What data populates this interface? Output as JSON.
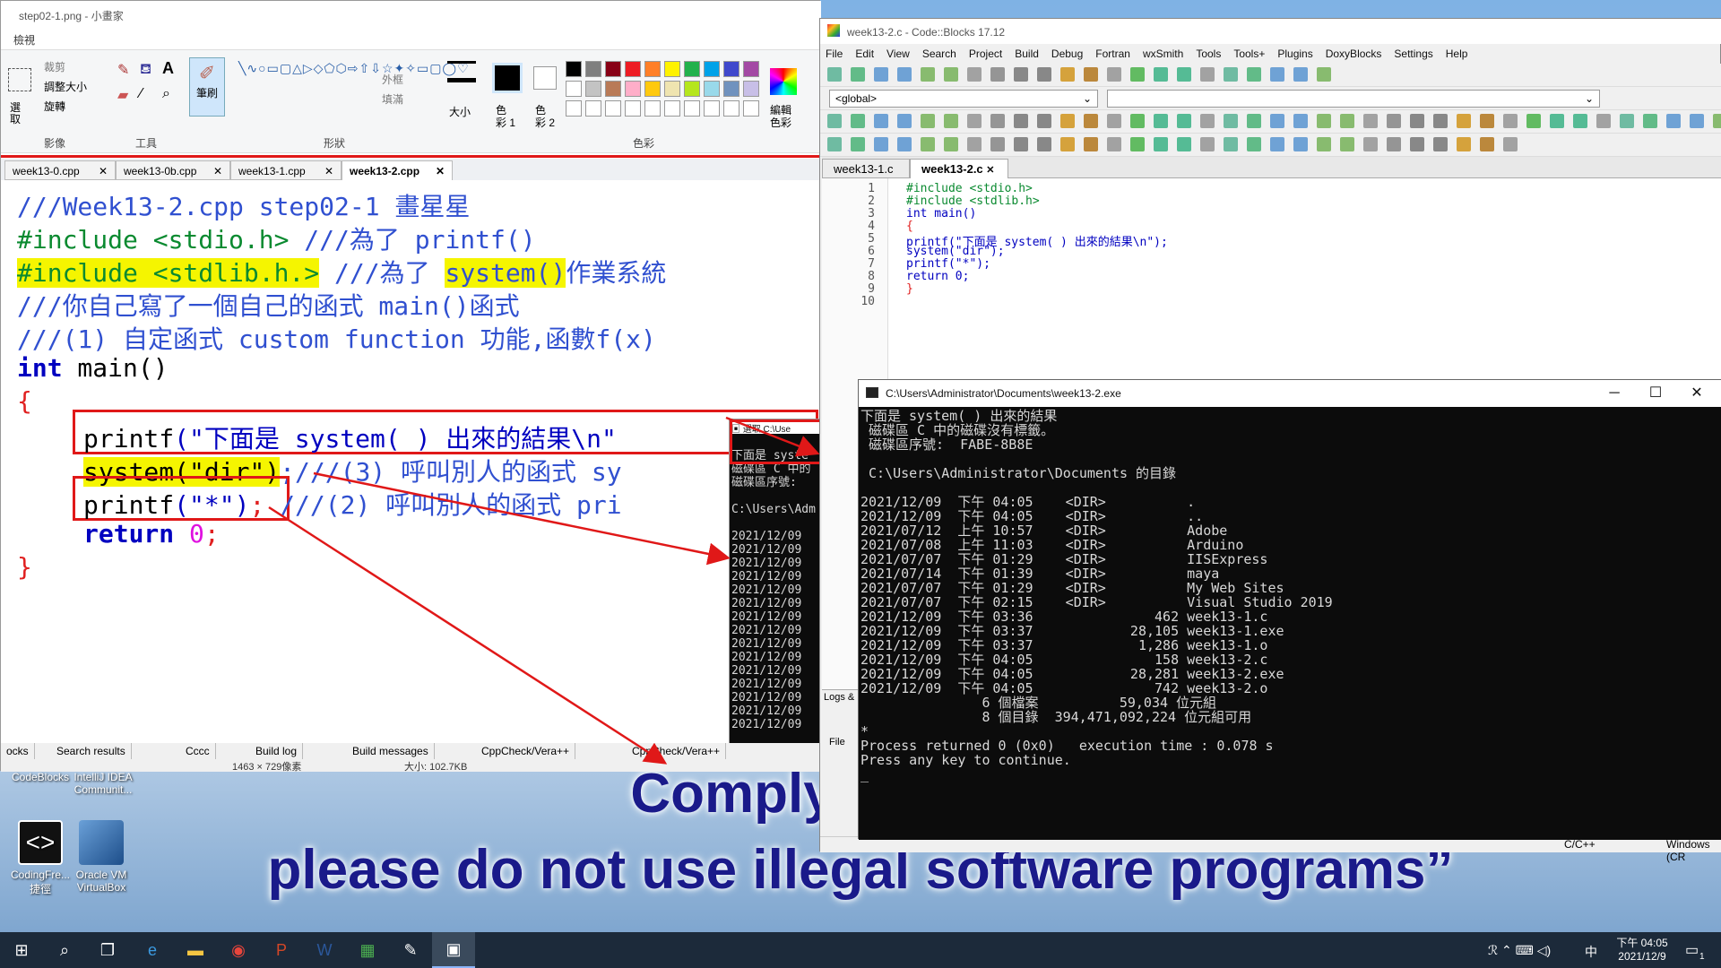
{
  "desktop": {
    "caption_line1": "Comply with Intel",
    "caption_line2": "please do not use illegal software programs”",
    "icons": [
      {
        "label": "CodeBlocks",
        "label2": "IntelliJ IDEA Communit..."
      },
      {
        "label": "CodingFre...",
        "label2": "捷徑"
      },
      {
        "label": "Oracle VM",
        "label2": "VirtualBox"
      }
    ]
  },
  "taskbar": {
    "time": "下午 04:05",
    "date": "2021/12/9",
    "ime": "中",
    "notif_count": "1"
  },
  "paint": {
    "title": "step02-1.png - 小畫家",
    "menu_view": "檢視",
    "ribbon": {
      "select": "選取",
      "crop": "裁剪",
      "resize": "調整大小",
      "rotate": "旋轉",
      "group_image": "影像",
      "group_tools": "工具",
      "brush": "筆刷",
      "group_shapes": "形狀",
      "outline": "外框",
      "fill": "填滿",
      "size": "大小",
      "color1": "色彩 1",
      "color2": "色彩 2",
      "group_colors": "色彩",
      "edit_colors": "編輯色彩"
    },
    "palette": [
      "#000000",
      "#7f7f7f",
      "#880015",
      "#ed1c24",
      "#ff7f27",
      "#fff200",
      "#22b14c",
      "#00a2e8",
      "#3f48cc",
      "#a349a4",
      "#ffffff",
      "#c3c3c3",
      "#b97a57",
      "#ffaec9",
      "#ffc90e",
      "#efe4b0",
      "#b5e61d",
      "#99d9ea",
      "#7092be",
      "#c8bfe7"
    ],
    "tabs": [
      "week13-0.cpp",
      "week13-0b.cpp",
      "week13-1.cpp",
      "week13-2.cpp"
    ],
    "code": {
      "l1": "///Week13-2.cpp step02-1 畫星星",
      "l2a": "#include <stdio.h>",
      "l2b": " ///為了 printf()",
      "l3a": "#include <stdlib.h.>",
      "l3b": " ///為了 ",
      "l3c": "system()",
      "l3d": "作業系統",
      "l4": "///你自己寫了一個自己的函式 main()函式",
      "l5": "///(1) 自定函式 custom function 功能,函數f(x)",
      "l6a": "int",
      "l6b": " main()",
      "l7": "{",
      "l8a": "printf",
      "l8b": "(\"下面是 system( ) 出來的結果\\n\"",
      "l9a": "system(\"dir\")",
      "l9b": ";///(3) 呼叫別人的函式 sy",
      "l10a": "printf",
      "l10b": "(\"*\")",
      "l10c": ";",
      "l10d": " ///(2) 呼叫別人的函式 pri",
      "l11a": "return",
      "l11b": " 0",
      "l11c": ";",
      "l12": "}"
    },
    "bottom_tabs": [
      "ocks",
      "Search results",
      "Cccc",
      "Build log",
      "Build messages",
      "CppCheck/Vera++",
      "CppCheck/Vera++"
    ],
    "status_size": "1463 × 729像素",
    "status_file": "大小: 102.7KB",
    "mini_console": [
      "下面是 syste",
      "磁碟區 C 中的",
      "磁碟區序號:",
      "",
      "C:\\Users\\Adm",
      "",
      "2021/12/09",
      "2021/12/09",
      "2021/12/09",
      "2021/12/09",
      "2021/12/09",
      "2021/12/09",
      "2021/12/09",
      "2021/12/09",
      "2021/12/09",
      "2021/12/09",
      "2021/12/09",
      "2021/12/09",
      "2021/12/09",
      "2021/12/09",
      "2021/12/09"
    ]
  },
  "codeblocks": {
    "title": "week13-2.c - Code::Blocks 17.12",
    "menu": [
      "File",
      "Edit",
      "View",
      "Search",
      "Project",
      "Build",
      "Debug",
      "Fortran",
      "wxSmith",
      "Tools",
      "Tools+",
      "Plugins",
      "DoxyBlocks",
      "Settings",
      "Help"
    ],
    "scope_combo": "<global>",
    "tabs": [
      "week13-1.c",
      "week13-2.c"
    ],
    "lines": [
      "#include <stdio.h>",
      "#include <stdlib.h>",
      "int main()",
      "{",
      "    printf(\"下面是 system( ) 出來的結果\\n\");",
      "    system(\"dir\");",
      "    printf(\"*\");",
      "    return 0;",
      "}",
      ""
    ],
    "line_numbers": [
      "1",
      "2",
      "3",
      "4",
      "5",
      "6",
      "7",
      "8",
      "9",
      "10"
    ],
    "logs_label": "Logs &",
    "file_label": "File",
    "status_lang": "C/C++",
    "status_os": "Windows (CR"
  },
  "console": {
    "title": "C:\\Users\\Administrator\\Documents\\week13-2.exe",
    "lines": [
      "下面是 system( ) 出來的結果",
      " 磁碟區 C 中的磁碟沒有標籤。",
      " 磁碟區序號:  FABE-8B8E",
      "",
      " C:\\Users\\Administrator\\Documents 的目錄",
      "",
      "2021/12/09  下午 04:05    <DIR>          .",
      "2021/12/09  下午 04:05    <DIR>          ..",
      "2021/07/12  上午 10:57    <DIR>          Adobe",
      "2021/07/08  上午 11:03    <DIR>          Arduino",
      "2021/07/07  下午 01:29    <DIR>          IISExpress",
      "2021/07/14  下午 01:39    <DIR>          maya",
      "2021/07/07  下午 01:29    <DIR>          My Web Sites",
      "2021/07/07  下午 02:15    <DIR>          Visual Studio 2019",
      "2021/12/09  下午 03:36               462 week13-1.c",
      "2021/12/09  下午 03:37            28,105 week13-1.exe",
      "2021/12/09  下午 03:37             1,286 week13-1.o",
      "2021/12/09  下午 04:05               158 week13-2.c",
      "2021/12/09  下午 04:05            28,281 week13-2.exe",
      "2021/12/09  下午 04:05               742 week13-2.o",
      "               6 個檔案          59,034 位元組",
      "               8 個目錄  394,471,092,224 位元組可用",
      "*",
      "Process returned 0 (0x0)   execution time : 0.078 s",
      "Press any key to continue.",
      "_"
    ]
  }
}
